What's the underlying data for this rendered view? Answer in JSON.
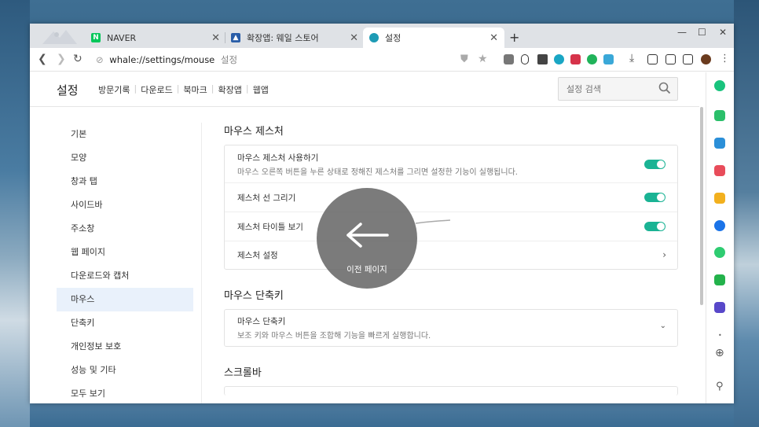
{
  "tabs": [
    {
      "title": "NAVER",
      "favicon": "naver-icon"
    },
    {
      "title": "확장앱: 웨일 스토어",
      "favicon": "store-icon"
    },
    {
      "title": "설정",
      "favicon": "whale-icon",
      "active": true
    }
  ],
  "window_controls": {
    "minimize": "—",
    "maximize": "☐",
    "close": "✕"
  },
  "address_bar": {
    "url": "whale://settings/mouse",
    "page_title": "설정"
  },
  "settings": {
    "title": "설정",
    "nav": [
      "방문기록",
      "다운로드",
      "북마크",
      "확장앱",
      "웹앱"
    ],
    "search_placeholder": "설정 검색"
  },
  "sidebar": {
    "items": [
      "기본",
      "모양",
      "창과 탭",
      "사이드바",
      "주소창",
      "웹 페이지",
      "다운로드와 캡처",
      "마우스",
      "단축키",
      "개인정보 보호",
      "성능 및 기타",
      "모두 보기"
    ],
    "active_index": 7
  },
  "sections": [
    {
      "title": "마우스 제스처",
      "rows": [
        {
          "label": "마우스 제스처 사용하기",
          "desc": "마우스 오른쪽 버튼을 누른 상태로 정해진 제스처를 그리면 설정한 기능이 실행됩니다.",
          "control": "toggle",
          "on": true
        },
        {
          "label": "제스처 선 그리기",
          "control": "toggle",
          "on": true
        },
        {
          "label": "제스처 타이틀 보기",
          "control": "toggle",
          "on": true
        },
        {
          "label": "제스처 설정",
          "control": "chevron-right"
        }
      ]
    },
    {
      "title": "마우스 단축키",
      "rows": [
        {
          "label": "마우스 단축키",
          "desc": "보조 키와 마우스 버튼을 조합해 기능을 빠르게 실행합니다.",
          "control": "chevron-down"
        }
      ]
    },
    {
      "title": "스크롤바",
      "rows": []
    }
  ],
  "gesture_overlay": {
    "label": "이전 페이지",
    "icon": "arrow-left-icon"
  },
  "colors": {
    "toggle_on": "#1ab394",
    "active_sidebar": "#e9f1fb",
    "tabbar": "#dfe2e6"
  }
}
